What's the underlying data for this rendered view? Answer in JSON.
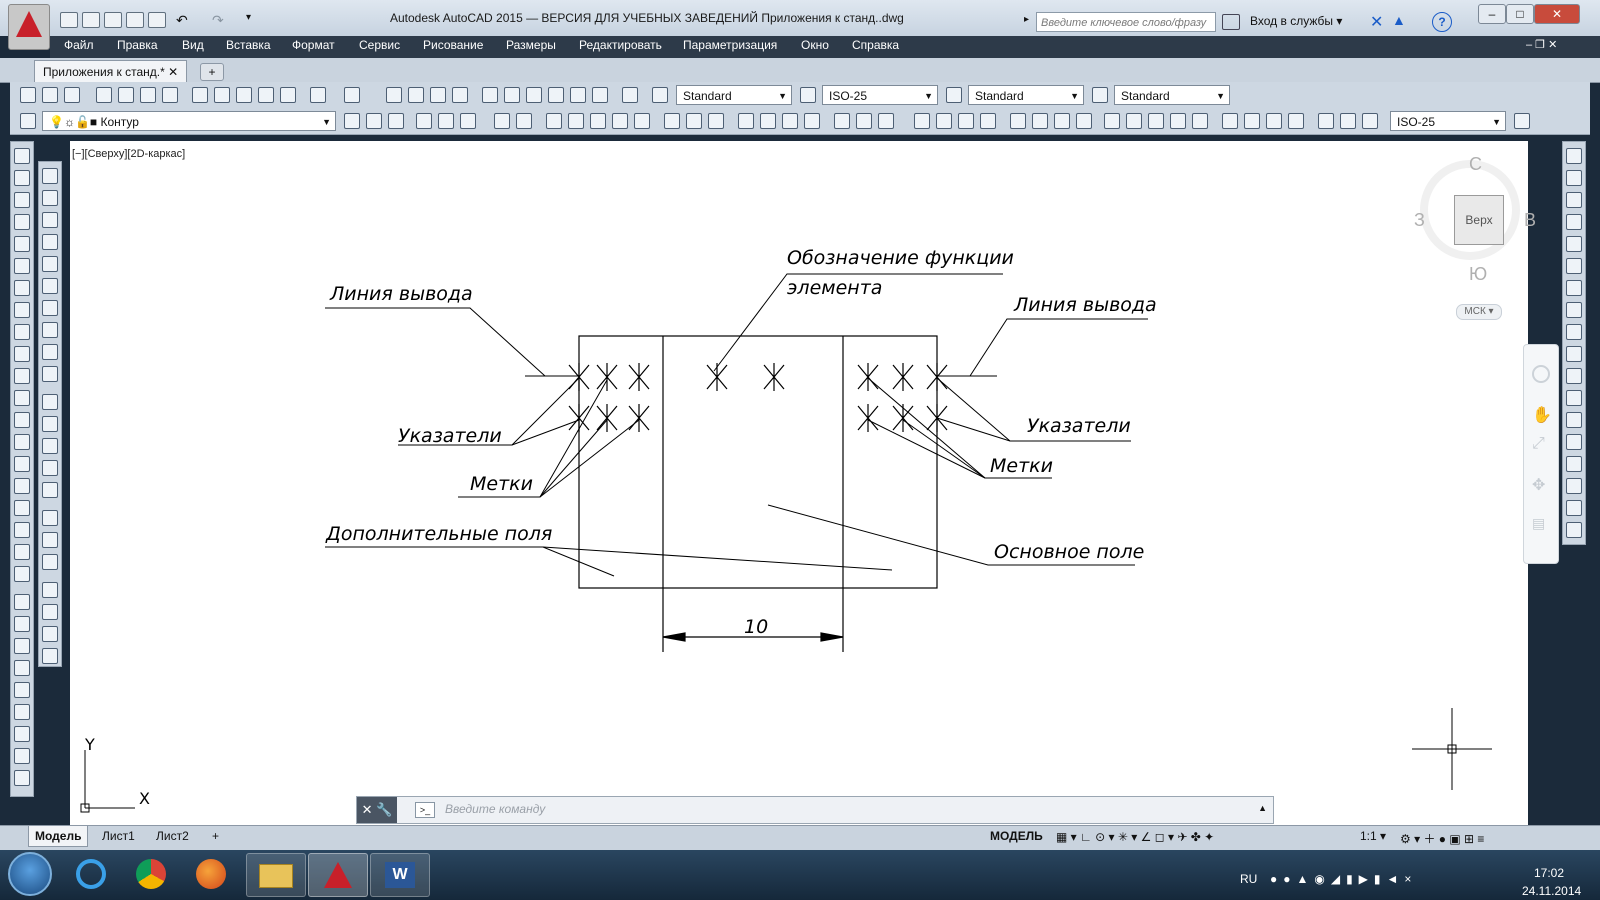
{
  "window": {
    "title": "Autodesk AutoCAD 2015 — ВЕРСИЯ ДЛЯ УЧЕБНЫХ ЗАВЕДЕНИЙ     Приложения к станд..dwg",
    "search_placeholder": "Введите ключевое слово/фразу",
    "signin_label": "Вход в службы",
    "help_icon": "help-icon",
    "minimize_icon": "minimize-icon",
    "maximize_icon": "maximize-icon",
    "close_icon": "close-icon"
  },
  "menu": [
    "Файл",
    "Правка",
    "Вид",
    "Вставка",
    "Формат",
    "Сервис",
    "Рисование",
    "Размеры",
    "Редактировать",
    "Параметризация",
    "Окно",
    "Справка"
  ],
  "document_tab": "Приложения к станд.*",
  "new_tab_symbol": "+",
  "toolbar1": {
    "text_style": "Standard",
    "dim_style": "ISO-25",
    "table_style": "Standard",
    "mleader_style": "Standard"
  },
  "toolbar2": {
    "layer": "Контур",
    "dim_style": "ISO-25"
  },
  "viewport_label": "[−][Сверху][2D-каркас]",
  "viewcube": {
    "north": "С",
    "south": "Ю",
    "west": "З",
    "east": "В",
    "face": "Верх",
    "ucs": "МСК"
  },
  "drawing": {
    "labels": {
      "lead_left": "Линия вывода",
      "lead_right": "Линия вывода",
      "function_line1": "Обозначение функции",
      "function_line2": "элемента",
      "pointers_left": "Указатели",
      "pointers_right": "Указатели",
      "marks_left": "Метки",
      "marks_right": "Метки",
      "extra_fields": "Дополнительные поля",
      "main_field": "Основное поле",
      "dimension": "10"
    },
    "ucs_x": "X",
    "ucs_y": "Y"
  },
  "command_line": {
    "placeholder": "Введите команду"
  },
  "layout_tabs": [
    "Модель",
    "Лист1",
    "Лист2"
  ],
  "status": {
    "mode": "МОДЕЛЬ",
    "scale": "1:1"
  },
  "taskbar": {
    "language": "RU",
    "time": "17:02",
    "date": "24.11.2014"
  }
}
